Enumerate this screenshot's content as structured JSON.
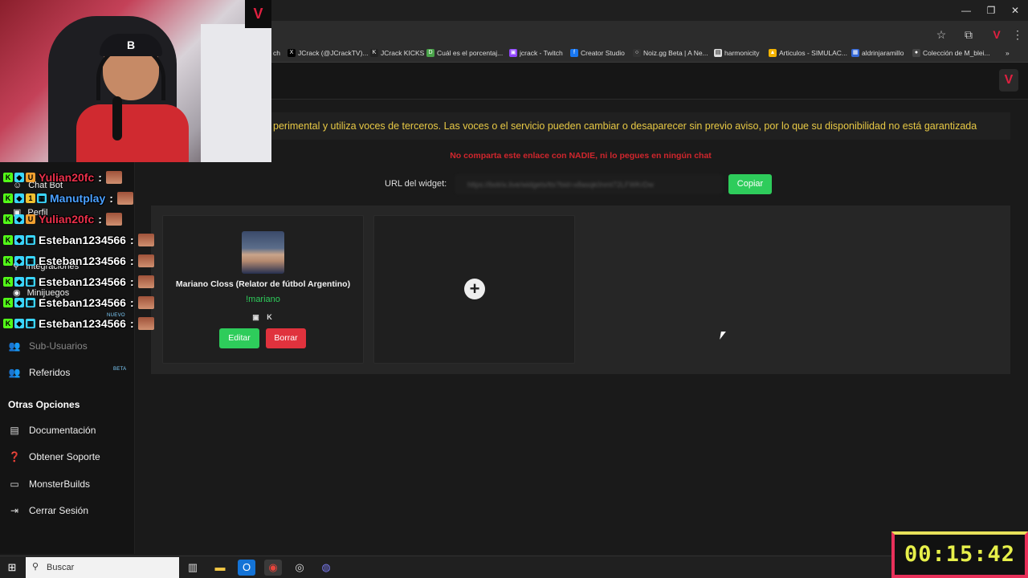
{
  "window": {
    "minimize": "—",
    "maximize": "❐",
    "close": "✕"
  },
  "bookmarks": [
    {
      "label": "ch",
      "color": "#888888"
    },
    {
      "label": "JCrack (@JCrackTV)...",
      "color": "#000000"
    },
    {
      "label": "JCrack KICKS",
      "color": "#222222"
    },
    {
      "label": "Cuál es el porcentaj...",
      "color": "#4aa34a"
    },
    {
      "label": "jcrack - Twitch",
      "color": "#9146ff"
    },
    {
      "label": "Creator Studio",
      "color": "#1877f2"
    },
    {
      "label": "Noiz.gg Beta | A Ne...",
      "color": "#333333"
    },
    {
      "label": "harmonicity",
      "color": "#dddddd"
    },
    {
      "label": "Articulos - SIMULAC...",
      "color": "#f4b400"
    },
    {
      "label": "aldrinjaramillo",
      "color": "#3367d6"
    },
    {
      "label": "Colección de M_blei...",
      "color": "#444444"
    }
  ],
  "chat": [
    {
      "user": "Yulian20fc",
      "color": "#e8304a",
      "badges": [
        "K",
        "◆",
        "U"
      ]
    },
    {
      "user": "Manutplay",
      "color": "#4aa0ff",
      "badges": [
        "K",
        "◆",
        "1",
        "▦"
      ]
    },
    {
      "user": "Yulian20fc",
      "color": "#e8304a",
      "badges": [
        "K",
        "◆",
        "U"
      ]
    },
    {
      "user": "Esteban1234566",
      "color": "#ffffff",
      "badges": [
        "K",
        "◆",
        "▦"
      ]
    },
    {
      "user": "Esteban1234566",
      "color": "#ffffff",
      "badges": [
        "K",
        "◆",
        "▦"
      ]
    },
    {
      "user": "Esteban1234566",
      "color": "#ffffff",
      "badges": [
        "K",
        "◆",
        "▦"
      ]
    },
    {
      "user": "Esteban1234566",
      "color": "#ffffff",
      "badges": [
        "K",
        "◆",
        "▦"
      ]
    },
    {
      "user": "Esteban1234566",
      "color": "#ffffff",
      "badges": [
        "K",
        "◆",
        "▦"
      ]
    }
  ],
  "sidebar": {
    "ghost_items": [
      "Chat Bot",
      "Perfil",
      "Integraciones",
      "Minijuegos"
    ],
    "new_tag": "NUEVO",
    "sub_users": "Sub-Usuarios",
    "referrals": "Referidos",
    "beta_tag": "BETA",
    "other_heading": "Otras Opciones",
    "docs": "Documentación",
    "support": "Obtener Soporte",
    "monsterbuilds": "MonsterBuilds",
    "logout": "Cerrar Sesión"
  },
  "main": {
    "warning": "perimental y utiliza voces de terceros. Las voces o el servicio pueden cambiar o desaparecer sin previo aviso, por lo que su disponibilidad no está garantizada",
    "share_warning": "No comparta este enlace con NADIE, ni lo pegues en ningún chat",
    "url_label": "URL del widget:",
    "url_value": "https://botrix.live/widgets/tts?bid=x8asqk0nmt72LFWKrDw",
    "copy": "Copiar",
    "voice": {
      "name": "Mariano Closs (Relator de fútbol Argentino)",
      "command": "!mariano",
      "edit": "Editar",
      "delete": "Borrar"
    }
  },
  "taskbar": {
    "search_placeholder": "Buscar"
  },
  "timer": "00:15:42",
  "colors": {
    "accent_green": "#2ecc5b",
    "danger_red": "#e0323d",
    "warning_yellow": "#e8c945"
  }
}
